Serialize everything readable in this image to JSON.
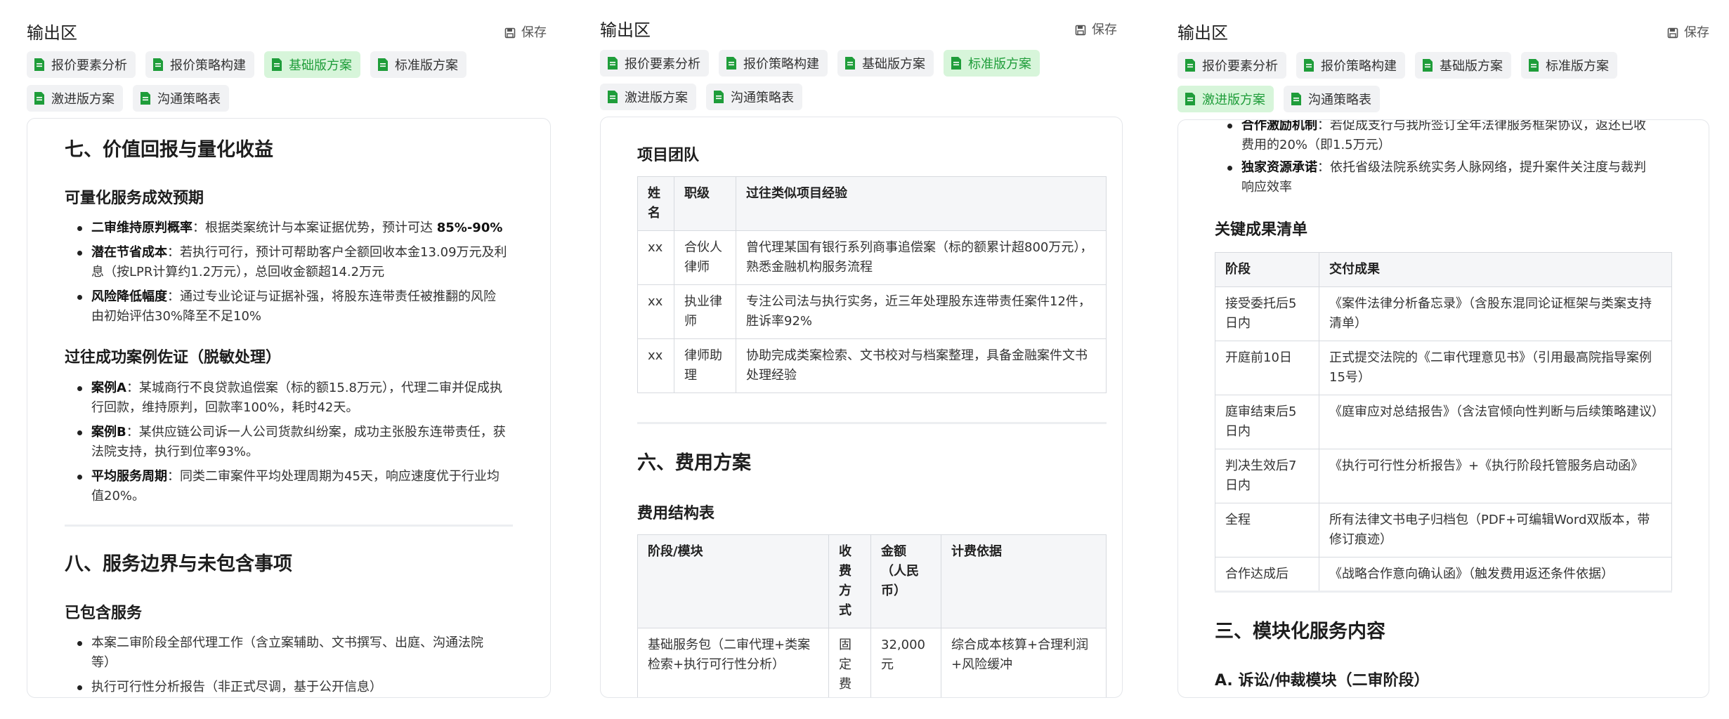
{
  "panels": [
    {
      "title": "输出区",
      "save_label": "保存",
      "tabs": [
        "报价要素分析",
        "报价策略构建",
        "基础版方案",
        "标准版方案",
        "激进版方案",
        "沟通策略表"
      ],
      "active_tab": 2,
      "doc": {
        "h2_a": "七、价值回报与量化收益",
        "h3_a": "可量化服务成效预期",
        "bullets_a": [
          {
            "b": "二审维持原判概率",
            "t": "：根据类案统计与本案证据优势，预计可达 ",
            "b2": "85%-90%"
          },
          {
            "b": "潜在节省成本",
            "t": "：若执行可行，预计可帮助客户全额回收本金13.09万元及利",
            "t2": "息（按LPR计算约1.2万元），总回收金额超14.2万元"
          },
          {
            "b": "风险降低幅度",
            "t": "：通过专业论证与证据补强，将股东连带责任被推翻的风险",
            "t2": "由初始评估30%降至不足10%"
          }
        ],
        "h3_b": "过往成功案例佐证（脱敏处理）",
        "bullets_b": [
          {
            "b": "案例A",
            "t": "：某城商行不良贷款追偿案（标的额15.8万元），代理二审并促成执",
            "t2": "行回款，维持原判，回款率100%，耗时42天。"
          },
          {
            "b": "案例B",
            "t": "：某供应链公司诉一人公司货款纠纷案，成功主张股东连带责任，获",
            "t2": "法院支持，执行到位率93%。"
          },
          {
            "b": "平均服务周期",
            "t": "：同类二审案件平均处理周期为45天，响应速度优于行业均",
            "t2": "值20%。"
          }
        ],
        "h2_b": "八、服务边界与未包含事项",
        "h3_c": "已包含服务",
        "bullets_c": [
          {
            "t": "本案二审阶段全部代理工作（含立案辅助、文书撰写、出庭、沟通法院",
            "t2": "等）"
          },
          {
            "t": "执行可行性分析报告（非正式尽调，基于公开信息）"
          }
        ]
      }
    },
    {
      "title": "输出区",
      "save_label": "保存",
      "tabs": [
        "报价要素分析",
        "报价策略构建",
        "基础版方案",
        "标准版方案",
        "激进版方案",
        "沟通策略表"
      ],
      "active_tab": 3,
      "doc": {
        "h3_a": "项目团队",
        "team_headers": [
          "姓名",
          "职级",
          "过往类似项目经验"
        ],
        "team_rows": [
          [
            "xx",
            "合伙人律师",
            "曾代理某国有银行系列商事追偿案（标的额累计超800万元），熟悉金融机构服务流程"
          ],
          [
            "xx",
            "执业律师",
            "专注公司法与执行实务，近三年处理股东连带责任案件12件，胜诉率92%"
          ],
          [
            "xx",
            "律师助理",
            "协助完成类案检索、文书校对与档案整理，具备金融案件文书处理经验"
          ]
        ],
        "h2_a": "六、费用方案",
        "h3_b": "费用结构表",
        "fee_headers": [
          "阶段/模块",
          "收费方式",
          "金额（人民币）",
          "计费依据"
        ],
        "fee_rows": [
          [
            "基础服务包（二审代理+类案检索+执行可行性分析）",
            "固定费用",
            "32,000元",
            "综合成本核算+合理利润+风险缓冲"
          ]
        ]
      }
    },
    {
      "title": "输出区",
      "save_label": "保存",
      "tabs": [
        "报价要素分析",
        "报价策略构建",
        "基础版方案",
        "标准版方案",
        "激进版方案",
        "沟通策略表"
      ],
      "active_tab": 4,
      "doc": {
        "bullets_a": [
          {
            "b": "合作激励机制",
            "t": "：若促成支行与我所签订全年法律服务框架协议，返还已收",
            "t2": "费用的20%（即1.5万元）"
          },
          {
            "b": "独家资源承诺",
            "t": "：依托省级法院系统实务人脉网络，提升案件关注度与裁判",
            "t2": "响应效率"
          }
        ],
        "h3_a": "关键成果清单",
        "result_headers": [
          "阶段",
          "交付成果"
        ],
        "result_rows": [
          [
            "接受委托后5日内",
            "《案件法律分析备忘录》（含股东混同论证框架与类案支持清单）"
          ],
          [
            "开庭前10日",
            "正式提交法院的《二审代理意见书》（引用最高院指导案例15号）"
          ],
          [
            "庭审结束后5日内",
            "《庭审应对总结报告》（含法官倾向性判断与后续策略建议）"
          ],
          [
            "判决生效后7日内",
            "《执行可行性分析报告》+《执行阶段托管服务启动函》"
          ],
          [
            "全程",
            "所有法律文书电子归档包（PDF+可编辑Word双版本，带修订痕迹）"
          ],
          [
            "合作达成后",
            "《战略合作意向确认函》（触发费用返还条件依据）"
          ]
        ],
        "h2_a": "三、模块化服务内容",
        "h3_b": "A. 诉讼/仲裁模块（二审阶段）"
      }
    }
  ],
  "colors": {
    "accent": "#1f9d3a",
    "active_tab_bg": "#d7f5da",
    "tab_bg": "#f1f2f4"
  },
  "icons": {
    "save": "save-icon",
    "doc": "document-icon"
  }
}
